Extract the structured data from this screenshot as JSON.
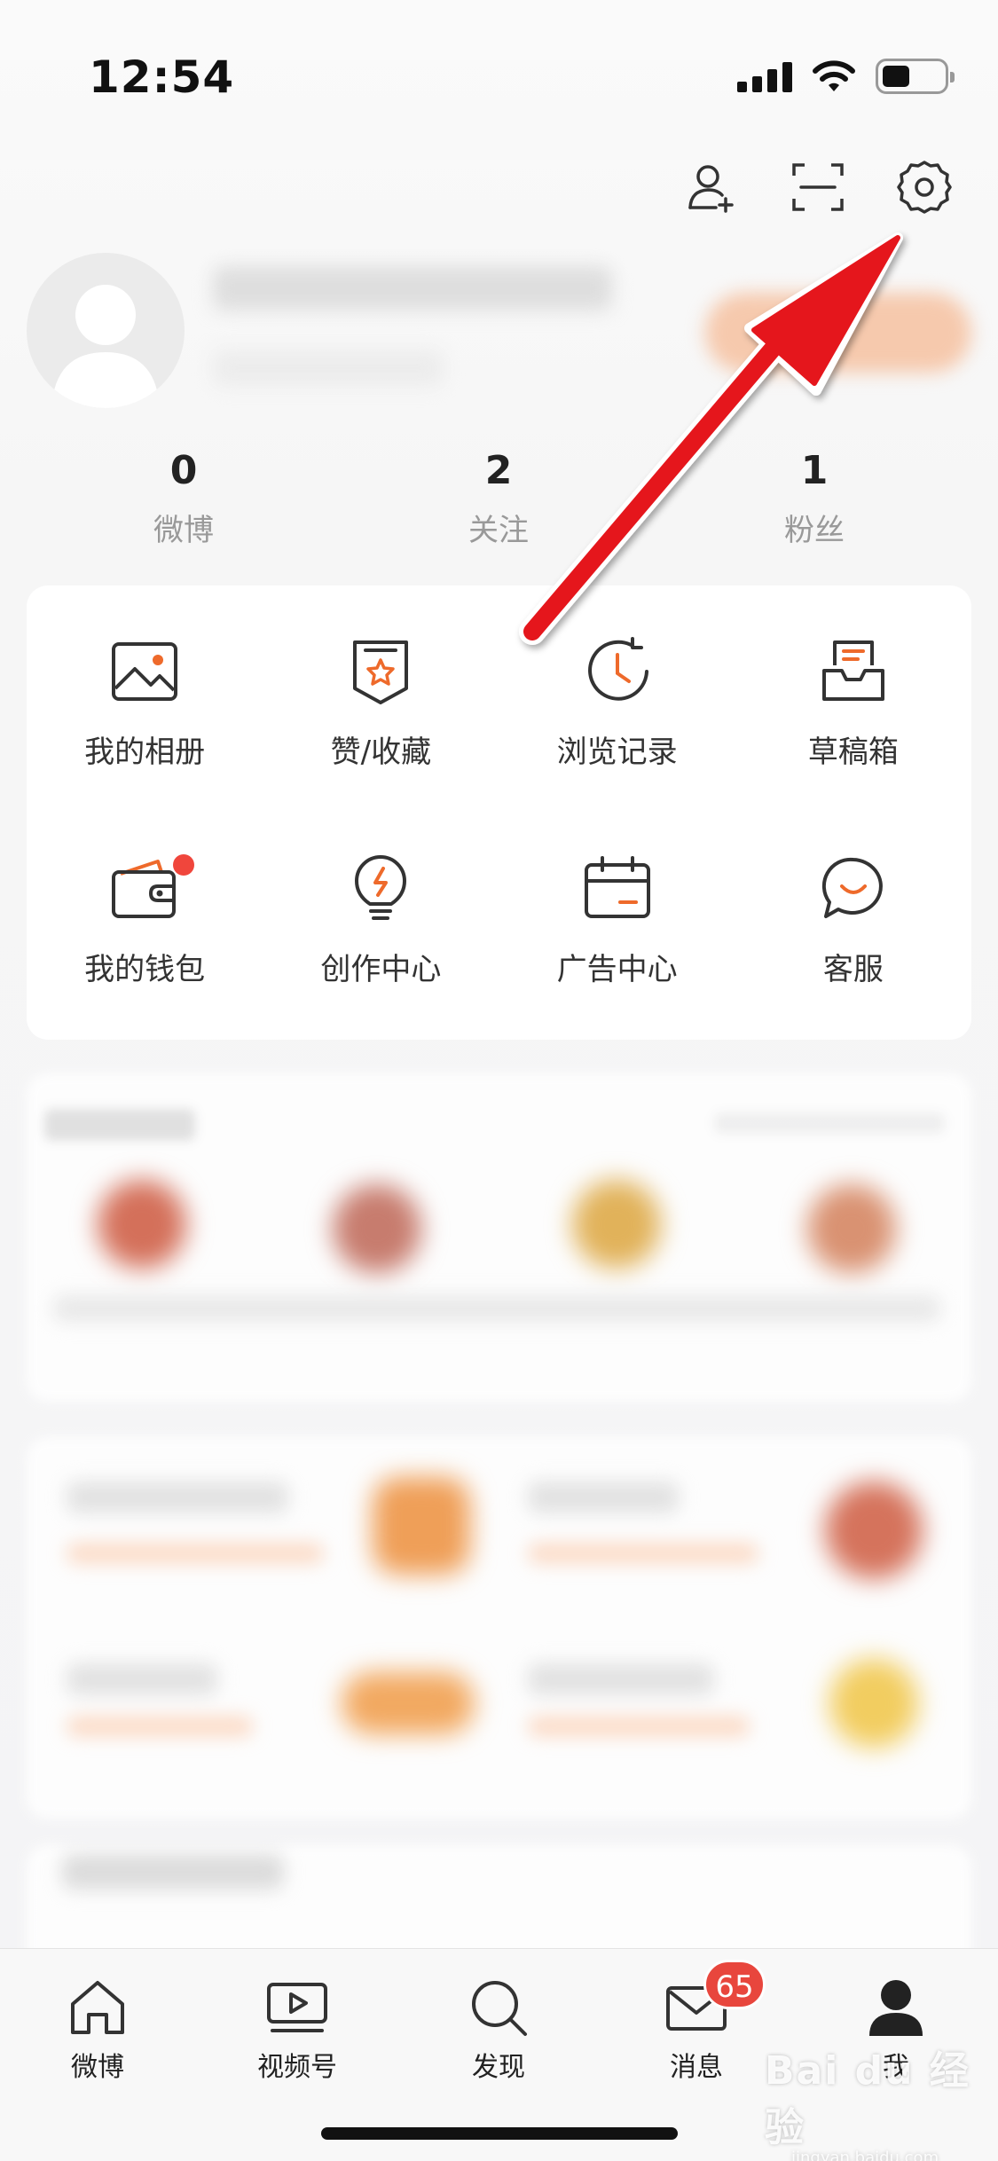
{
  "status_bar": {
    "time": "12:54"
  },
  "profile": {
    "name": "",
    "subtitle": ""
  },
  "stats": [
    {
      "count": "0",
      "label": "微博"
    },
    {
      "count": "2",
      "label": "关注"
    },
    {
      "count": "1",
      "label": "粉丝"
    }
  ],
  "features": [
    {
      "label": "我的相册",
      "icon": "album-icon"
    },
    {
      "label": "赞/收藏",
      "icon": "favorite-icon"
    },
    {
      "label": "浏览记录",
      "icon": "history-icon"
    },
    {
      "label": "草稿箱",
      "icon": "drafts-icon"
    },
    {
      "label": "我的钱包",
      "icon": "wallet-icon",
      "has_dot": true
    },
    {
      "label": "创作中心",
      "icon": "lightbulb-icon"
    },
    {
      "label": "广告中心",
      "icon": "calendar-icon"
    },
    {
      "label": "客服",
      "icon": "chat-icon"
    }
  ],
  "tabbar": {
    "items": [
      {
        "label": "微博",
        "icon": "home-icon"
      },
      {
        "label": "视频号",
        "icon": "video-icon"
      },
      {
        "label": "发现",
        "icon": "search-icon"
      },
      {
        "label": "消息",
        "icon": "mail-icon",
        "badge": "65"
      },
      {
        "label": "我",
        "icon": "person-icon",
        "active": true
      }
    ]
  },
  "colors": {
    "accent": "#ee6a2b",
    "badge": "#e8463d",
    "arrow": "#e5161e"
  },
  "watermark": {
    "brand": "Bai du 经验",
    "site": "jingyan.baidu.com"
  }
}
